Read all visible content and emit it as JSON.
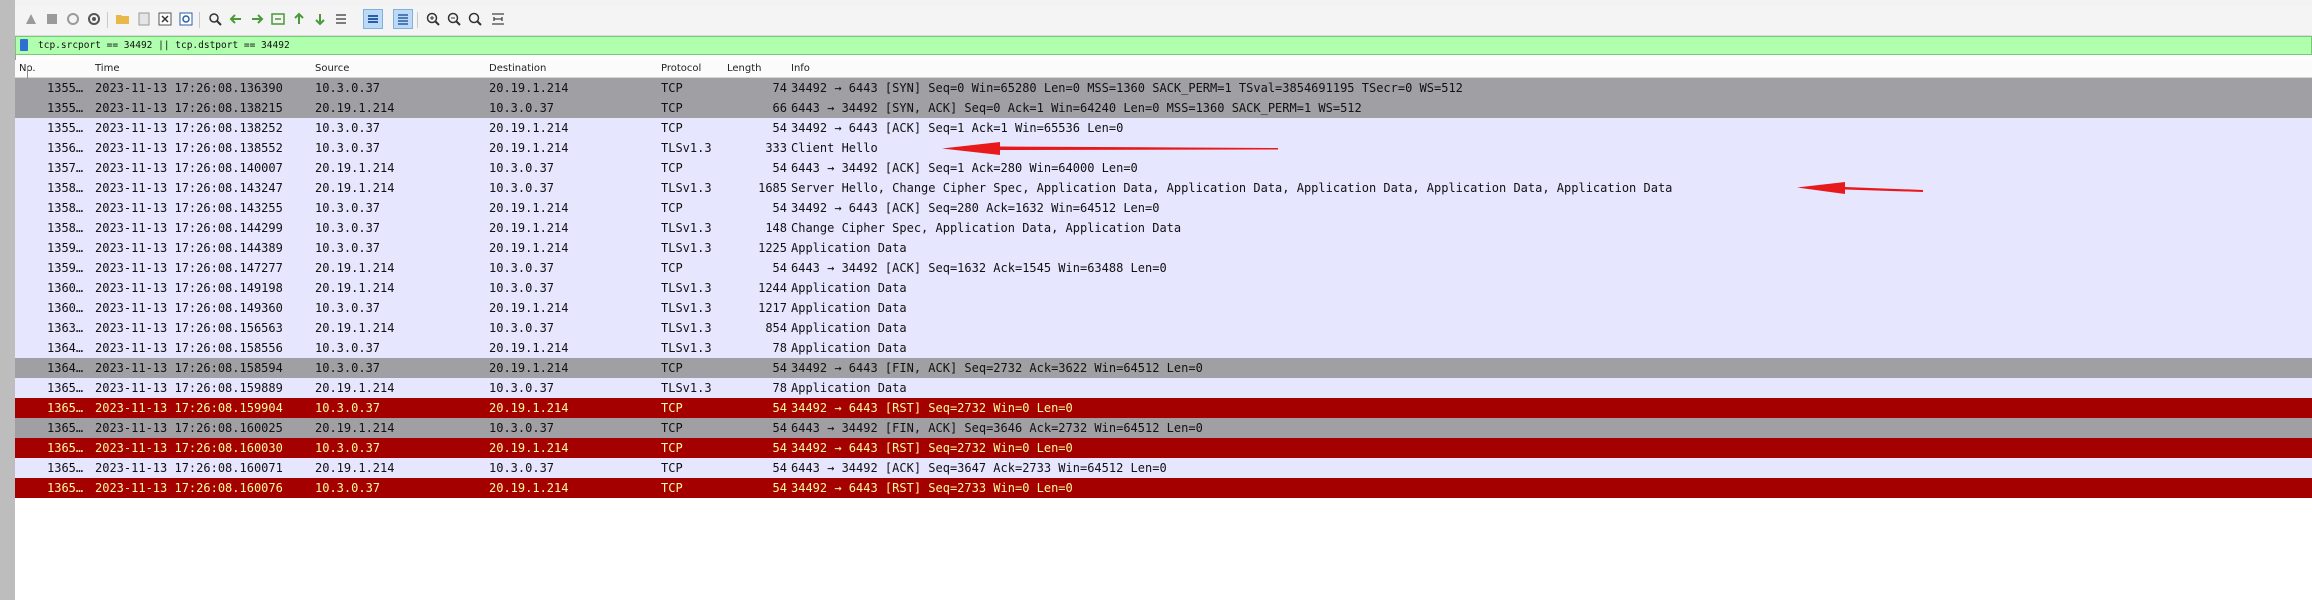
{
  "toolbar": {
    "icons": [
      "shark-fin-start-icon",
      "stop-icon",
      "restart-icon",
      "capture-options-icon",
      "open-folder-icon",
      "save-file-icon",
      "close-file-icon",
      "reload-icon",
      "find-icon",
      "go-back-icon",
      "go-forward-icon",
      "go-to-packet-icon",
      "go-first-icon",
      "go-last-icon",
      "auto-scroll-icon",
      "colorize-icon",
      "zoom-in-icon",
      "zoom-out-icon",
      "normal-size-icon",
      "resize-columns-icon"
    ]
  },
  "filter": {
    "value": "tcp.srcport == 34492 || tcp.dstport == 34492"
  },
  "columns": {
    "no": "No.",
    "time": "Time",
    "source": "Source",
    "destination": "Destination",
    "protocol": "Protocol",
    "length": "Length",
    "info": "Info"
  },
  "colors": {
    "gray_row": "#a0a0a4",
    "lavender_row": "#e7e6ff",
    "red_row": "#a40000",
    "red_row_text": "#fffc9c",
    "filter_ok": "#afffaf",
    "annotation_arrow": "#e8191a"
  },
  "packets": [
    {
      "no": "1355…",
      "time": "2023-11-13 17:26:08.136390",
      "src": "10.3.0.37",
      "dst": "20.19.1.214",
      "proto": "TCP",
      "len": "74",
      "info": "34492 → 6443 [SYN] Seq=0 Win=65280 Len=0 MSS=1360 SACK_PERM=1 TSval=3854691195 TSecr=0 WS=512",
      "style": "gray"
    },
    {
      "no": "1355…",
      "time": "2023-11-13 17:26:08.138215",
      "src": "20.19.1.214",
      "dst": "10.3.0.37",
      "proto": "TCP",
      "len": "66",
      "info": "6443 → 34492 [SYN, ACK] Seq=0 Ack=1 Win=64240 Len=0 MSS=1360 SACK_PERM=1 WS=512",
      "style": "gray"
    },
    {
      "no": "1355…",
      "time": "2023-11-13 17:26:08.138252",
      "src": "10.3.0.37",
      "dst": "20.19.1.214",
      "proto": "TCP",
      "len": "54",
      "info": "34492 → 6443 [ACK] Seq=1 Ack=1 Win=65536 Len=0",
      "style": "lav"
    },
    {
      "no": "1356…",
      "time": "2023-11-13 17:26:08.138552",
      "src": "10.3.0.37",
      "dst": "20.19.1.214",
      "proto": "TLSv1.3",
      "len": "333",
      "info": "Client Hello",
      "style": "lav"
    },
    {
      "no": "1357…",
      "time": "2023-11-13 17:26:08.140007",
      "src": "20.19.1.214",
      "dst": "10.3.0.37",
      "proto": "TCP",
      "len": "54",
      "info": "6443 → 34492 [ACK] Seq=1 Ack=280 Win=64000 Len=0",
      "style": "lav"
    },
    {
      "no": "1358…",
      "time": "2023-11-13 17:26:08.143247",
      "src": "20.19.1.214",
      "dst": "10.3.0.37",
      "proto": "TLSv1.3",
      "len": "1685",
      "info": "Server Hello, Change Cipher Spec, Application Data, Application Data, Application Data, Application Data, Application Data",
      "style": "lav"
    },
    {
      "no": "1358…",
      "time": "2023-11-13 17:26:08.143255",
      "src": "10.3.0.37",
      "dst": "20.19.1.214",
      "proto": "TCP",
      "len": "54",
      "info": "34492 → 6443 [ACK] Seq=280 Ack=1632 Win=64512 Len=0",
      "style": "lav"
    },
    {
      "no": "1358…",
      "time": "2023-11-13 17:26:08.144299",
      "src": "10.3.0.37",
      "dst": "20.19.1.214",
      "proto": "TLSv1.3",
      "len": "148",
      "info": "Change Cipher Spec, Application Data, Application Data",
      "style": "lav"
    },
    {
      "no": "1359…",
      "time": "2023-11-13 17:26:08.144389",
      "src": "10.3.0.37",
      "dst": "20.19.1.214",
      "proto": "TLSv1.3",
      "len": "1225",
      "info": "Application Data",
      "style": "lav"
    },
    {
      "no": "1359…",
      "time": "2023-11-13 17:26:08.147277",
      "src": "20.19.1.214",
      "dst": "10.3.0.37",
      "proto": "TCP",
      "len": "54",
      "info": "6443 → 34492 [ACK] Seq=1632 Ack=1545 Win=63488 Len=0",
      "style": "lav"
    },
    {
      "no": "1360…",
      "time": "2023-11-13 17:26:08.149198",
      "src": "20.19.1.214",
      "dst": "10.3.0.37",
      "proto": "TLSv1.3",
      "len": "1244",
      "info": "Application Data",
      "style": "lav"
    },
    {
      "no": "1360…",
      "time": "2023-11-13 17:26:08.149360",
      "src": "10.3.0.37",
      "dst": "20.19.1.214",
      "proto": "TLSv1.3",
      "len": "1217",
      "info": "Application Data",
      "style": "lav"
    },
    {
      "no": "1363…",
      "time": "2023-11-13 17:26:08.156563",
      "src": "20.19.1.214",
      "dst": "10.3.0.37",
      "proto": "TLSv1.3",
      "len": "854",
      "info": "Application Data",
      "style": "lav"
    },
    {
      "no": "1364…",
      "time": "2023-11-13 17:26:08.158556",
      "src": "10.3.0.37",
      "dst": "20.19.1.214",
      "proto": "TLSv1.3",
      "len": "78",
      "info": "Application Data",
      "style": "lav"
    },
    {
      "no": "1364…",
      "time": "2023-11-13 17:26:08.158594",
      "src": "10.3.0.37",
      "dst": "20.19.1.214",
      "proto": "TCP",
      "len": "54",
      "info": "34492 → 6443 [FIN, ACK] Seq=2732 Ack=3622 Win=64512 Len=0",
      "style": "gray"
    },
    {
      "no": "1365…",
      "time": "2023-11-13 17:26:08.159889",
      "src": "20.19.1.214",
      "dst": "10.3.0.37",
      "proto": "TLSv1.3",
      "len": "78",
      "info": "Application Data",
      "style": "lav"
    },
    {
      "no": "1365…",
      "time": "2023-11-13 17:26:08.159904",
      "src": "10.3.0.37",
      "dst": "20.19.1.214",
      "proto": "TCP",
      "len": "54",
      "info": "34492 → 6443 [RST] Seq=2732 Win=0 Len=0",
      "style": "red"
    },
    {
      "no": "1365…",
      "time": "2023-11-13 17:26:08.160025",
      "src": "20.19.1.214",
      "dst": "10.3.0.37",
      "proto": "TCP",
      "len": "54",
      "info": "6443 → 34492 [FIN, ACK] Seq=3646 Ack=2732 Win=64512 Len=0",
      "style": "gray"
    },
    {
      "no": "1365…",
      "time": "2023-11-13 17:26:08.160030",
      "src": "10.3.0.37",
      "dst": "20.19.1.214",
      "proto": "TCP",
      "len": "54",
      "info": "34492 → 6443 [RST] Seq=2732 Win=0 Len=0",
      "style": "red"
    },
    {
      "no": "1365…",
      "time": "2023-11-13 17:26:08.160071",
      "src": "20.19.1.214",
      "dst": "10.3.0.37",
      "proto": "TCP",
      "len": "54",
      "info": "6443 → 34492 [ACK] Seq=3647 Ack=2733 Win=64512 Len=0",
      "style": "lav"
    },
    {
      "no": "1365…",
      "time": "2023-11-13 17:26:08.160076",
      "src": "10.3.0.37",
      "dst": "20.19.1.214",
      "proto": "TCP",
      "len": "54",
      "info": "34492 → 6443 [RST] Seq=2733 Win=0 Len=0",
      "style": "red"
    }
  ]
}
